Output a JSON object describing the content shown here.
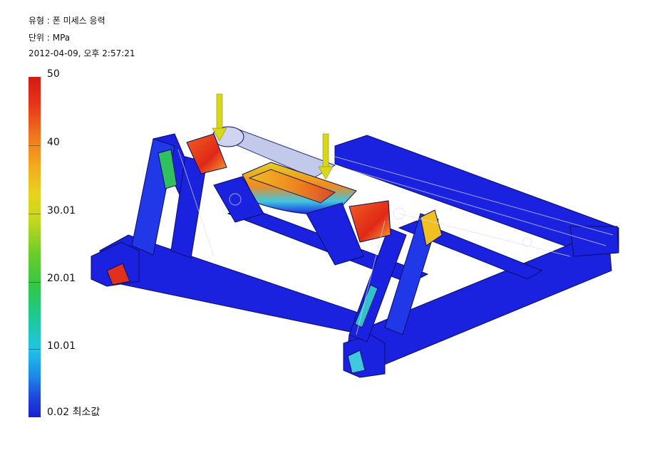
{
  "info": {
    "type_line": "유형 : 폰 미세스 응력",
    "unit_line": "단위 : MPa",
    "date_line": "2012-04-09, 오후 2:57:21"
  },
  "legend": {
    "ticks": [
      {
        "label": "50"
      },
      {
        "label": "40"
      },
      {
        "label": "30.01"
      },
      {
        "label": "20.01"
      },
      {
        "label": "10.01"
      },
      {
        "label": "0.02 최소값"
      }
    ],
    "max_color": "#d21a14",
    "min_color": "#1a20d0"
  },
  "model": {
    "frame_color": "#1a22e0",
    "load_arrow_color": "#d8d818",
    "load_arrow_count": 2
  }
}
